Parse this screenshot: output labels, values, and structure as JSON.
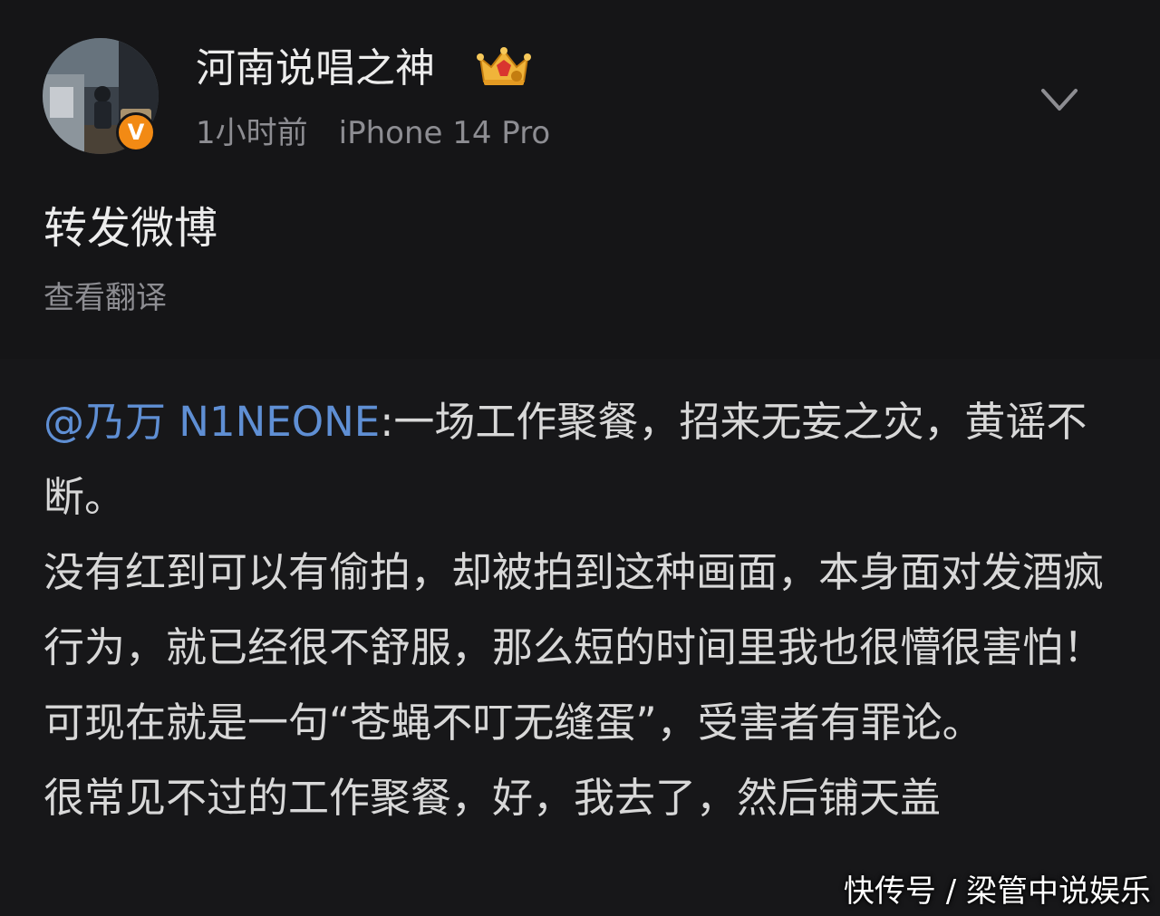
{
  "post": {
    "username": "河南说唱之神",
    "time": "1小时前",
    "device": "iPhone 14 Pro",
    "text": "转发微博",
    "translate_label": "查看翻译",
    "avatar_icon": "user-avatar-photo",
    "verified_icon": "verified-v-icon",
    "verified_badge_text": "V",
    "crown_icon": "crown-badge-icon",
    "more_icon": "chevron-down-icon"
  },
  "repost": {
    "mention": "@乃万 N1NEONE",
    "separator": ":",
    "paragraphs": [
      "一场工作聚餐，招来无妄之灾，黄谣不断。",
      "没有红到可以有偷拍，却被拍到这种画面，本身面对发酒疯行为，就已经很不舒服，那么短的时间里我也很懵很害怕！",
      "可现在就是一句“苍蝇不叮无缝蛋”，受害者有罪论。",
      "很常见不过的工作聚餐，好，我去了，然后铺天盖"
    ]
  },
  "watermark": "快传号 / 梁管中说娱乐",
  "colors": {
    "background": "#171719",
    "text": "#d8d8d8",
    "secondary_text": "#8d8d92",
    "mention": "#5f8fd4",
    "verified": "#f28a14"
  }
}
